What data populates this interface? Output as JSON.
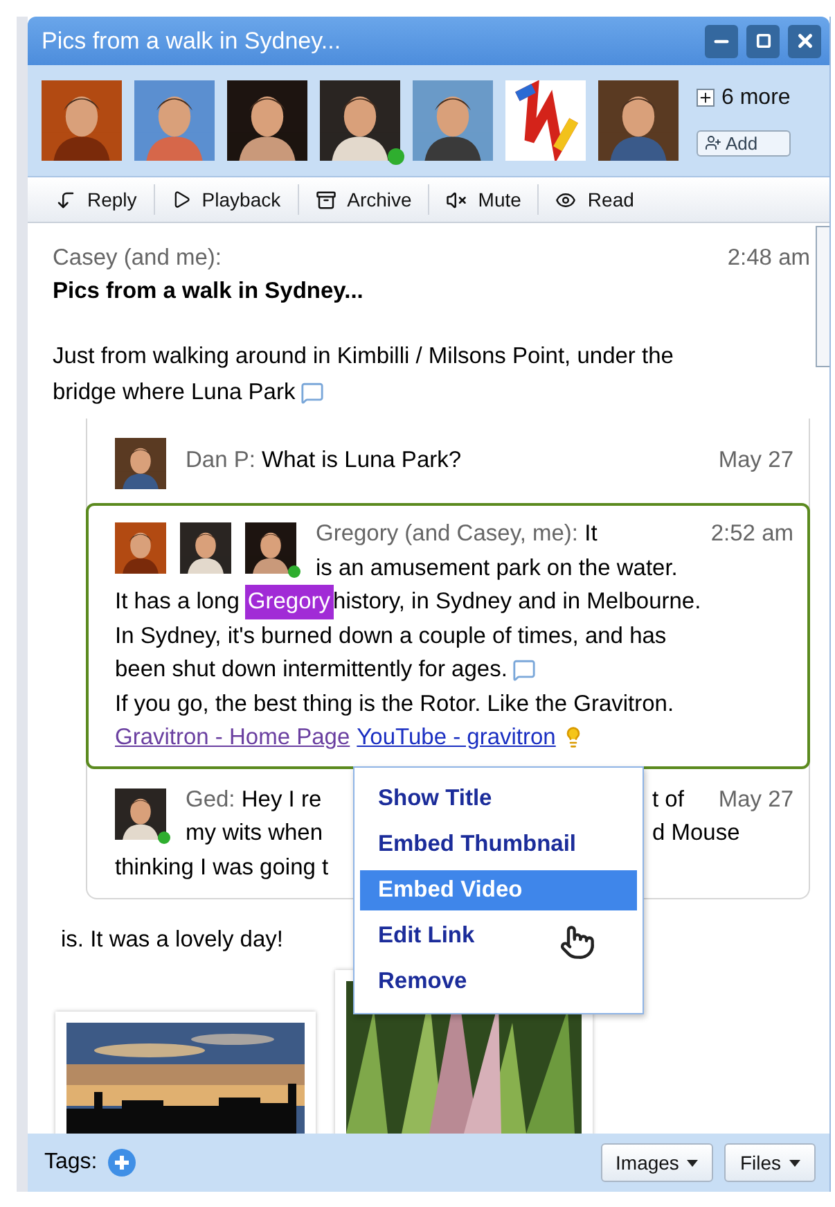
{
  "window": {
    "title": "Pics from a walk in Sydney..."
  },
  "participants": {
    "avatars": [
      {
        "kind": "person",
        "online": false
      },
      {
        "kind": "person",
        "online": false
      },
      {
        "kind": "person",
        "online": false
      },
      {
        "kind": "person",
        "online": true
      },
      {
        "kind": "person",
        "online": false
      },
      {
        "kind": "gadget",
        "online": false
      },
      {
        "kind": "person",
        "online": false
      }
    ],
    "more": "6 more",
    "add": "Add"
  },
  "toolbar": [
    {
      "kind": "reply",
      "label": "Reply"
    },
    {
      "kind": "playback",
      "label": "Playback"
    },
    {
      "kind": "archive",
      "label": "Archive"
    },
    {
      "kind": "mute",
      "label": "Mute"
    },
    {
      "kind": "read",
      "label": "Read"
    }
  ],
  "message": {
    "author": "Casey (and me):",
    "time": "2:48 am",
    "subject": "Pics from a walk in Sydney...",
    "lines": [
      {
        "text": "Just from walking around in Kimbilli / Milsons Point, under the"
      },
      {
        "text": "bridge where Luna Park",
        "comment": true
      }
    ],
    "closing": "is. It was a lovely day!"
  },
  "thread": [
    {
      "kind": "plain",
      "author": "Dan P:",
      "text": "What is Luna Park?",
      "date": "May 27",
      "selected": false,
      "avatars": [
        {
          "online": false
        }
      ]
    },
    {
      "kind": "editing",
      "author": "Gregory (and Casey, me):",
      "lead": "It",
      "time": "2:52 am",
      "selected": true,
      "avatars": [
        {
          "online": false
        },
        {
          "online": false
        },
        {
          "online": true
        }
      ],
      "first_line": "is an amusement park on the water.",
      "cursor_line": {
        "before": "It has a long",
        "cursor": "Gregory",
        "after": "history, in Sydney and in Melbourne."
      },
      "lines": [
        {
          "text": "In Sydney, it's burned down a couple of times, and has"
        },
        {
          "text": "been shut down intermittently for ages.",
          "comment": true
        },
        {
          "text": "If you go, the best thing is the Rotor. Like the Gravitron."
        }
      ],
      "links": [
        {
          "label": "Gravitron - Home Page",
          "visited": true
        },
        {
          "label": "YouTube - gravitron",
          "visited": false
        }
      ]
    },
    {
      "kind": "covered",
      "author": "Ged:",
      "date": "May 27",
      "selected": false,
      "avatars": [
        {
          "online": true
        }
      ],
      "fragments": [
        [
          "Hey I re",
          "t of"
        ],
        [
          "my wits when",
          "d Mouse"
        ],
        [
          "thinking I was going t"
        ]
      ]
    }
  ],
  "menu": {
    "items": [
      {
        "label": "Show Title",
        "selected": false
      },
      {
        "label": "Embed Thumbnail",
        "selected": false
      },
      {
        "label": "Embed Video",
        "selected": true
      },
      {
        "label": "Edit Link",
        "selected": false
      },
      {
        "label": "Remove",
        "selected": false
      }
    ]
  },
  "footer": {
    "tags": "Tags:",
    "buttons": [
      "Images",
      "Files"
    ]
  }
}
